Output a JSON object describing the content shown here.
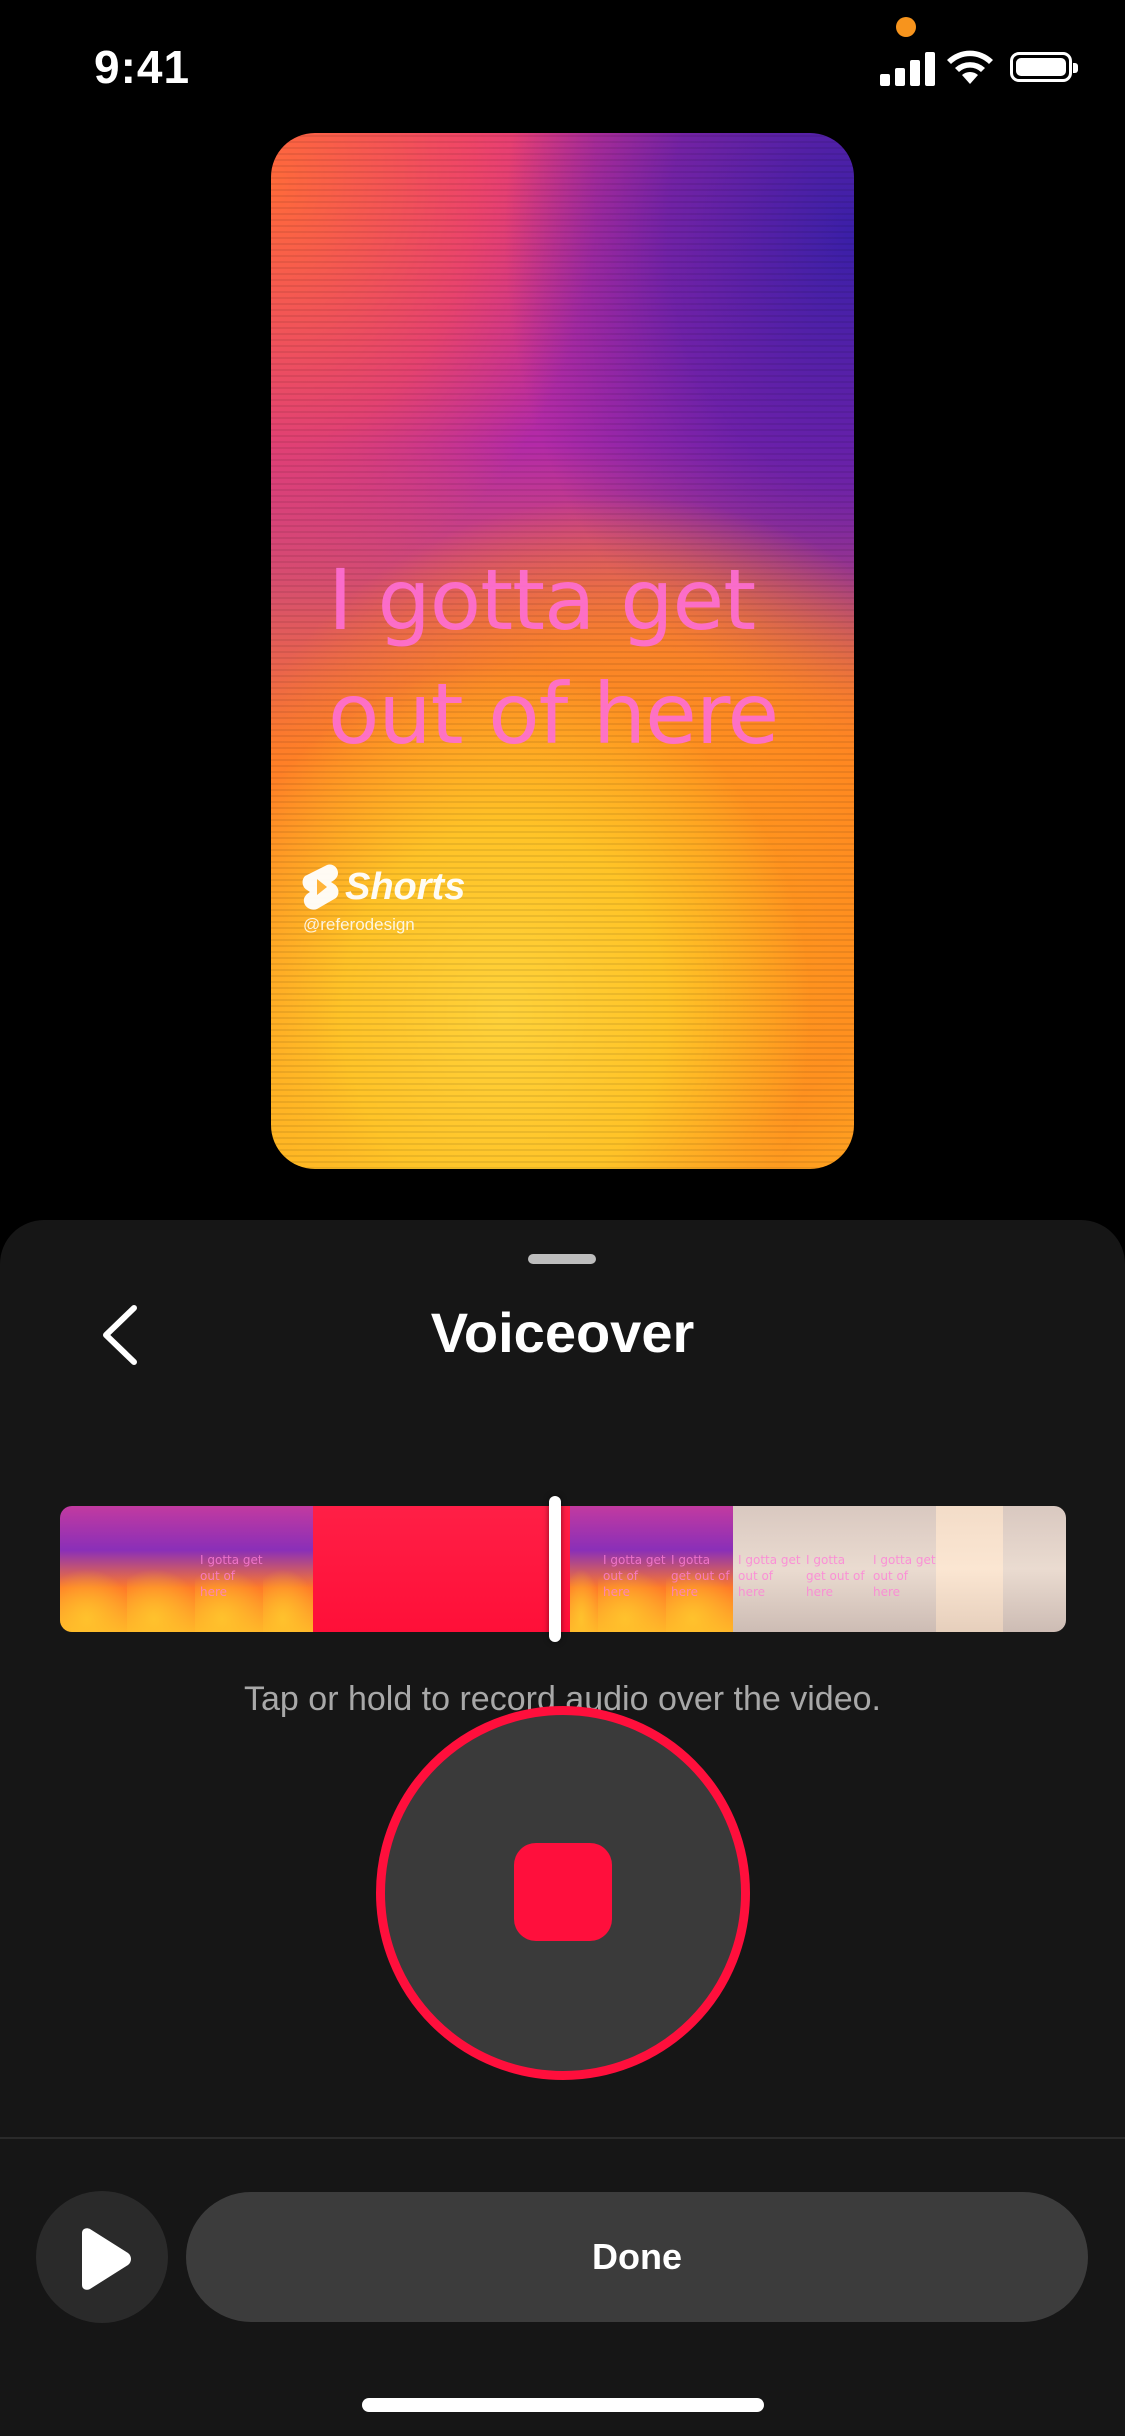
{
  "status_bar": {
    "time": "9:41"
  },
  "preview": {
    "caption_line1": "I gotta get",
    "caption_line2": "out of here",
    "logo_text": "Shorts",
    "handle": "@referodesign"
  },
  "sheet": {
    "title": "Voiceover",
    "hint": "Tap or hold to record audio over the video.",
    "done_label": "Done",
    "timeline_mini_caption": "I gotta get out of here"
  },
  "colors": {
    "record_accent": "#ff0f3c",
    "sheet_bg": "#161616",
    "recording_indicator": "#f7941d"
  },
  "icons": {
    "back": "chevron-left-icon",
    "play": "play-icon",
    "stop": "stop-icon"
  }
}
